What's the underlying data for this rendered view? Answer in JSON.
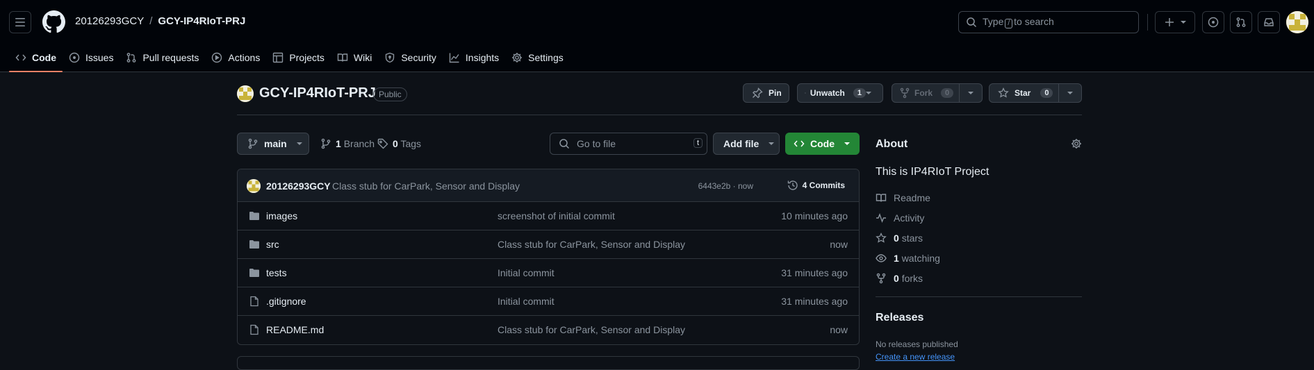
{
  "header": {
    "owner": "20126293GCY",
    "separator": "/",
    "repo": "GCY-IP4RIoT-PRJ",
    "search_pre": "Type",
    "search_key": "/",
    "search_post": "to search"
  },
  "tabs": [
    {
      "label": "Code",
      "icon": "code-icon"
    },
    {
      "label": "Issues",
      "icon": "issue-icon"
    },
    {
      "label": "Pull requests",
      "icon": "pull-request-icon"
    },
    {
      "label": "Actions",
      "icon": "play-icon"
    },
    {
      "label": "Projects",
      "icon": "table-icon"
    },
    {
      "label": "Wiki",
      "icon": "book-icon"
    },
    {
      "label": "Security",
      "icon": "shield-icon"
    },
    {
      "label": "Insights",
      "icon": "graph-icon"
    },
    {
      "label": "Settings",
      "icon": "gear-icon"
    }
  ],
  "repo_head": {
    "title": "GCY-IP4RIoT-PRJ",
    "visibility": "Public",
    "pin": "Pin",
    "unwatch": "Unwatch",
    "unwatch_count": "1",
    "fork": "Fork",
    "fork_count": "0",
    "star": "Star",
    "star_count": "0"
  },
  "branch_bar": {
    "branch": "main",
    "branches_count": "1",
    "branches_label": "Branch",
    "tags_count": "0",
    "tags_label": "Tags",
    "goto_placeholder": "Go to file",
    "goto_key": "t",
    "add_file": "Add file",
    "code": "Code"
  },
  "commit": {
    "user": "20126293GCY",
    "message": "Class stub for CarPark, Sensor and Display",
    "meta": "6443e2b · now",
    "commits": "4 Commits"
  },
  "files": [
    {
      "type": "folder",
      "name": "images",
      "message": "screenshot of initial commit",
      "time": "10 minutes ago"
    },
    {
      "type": "folder",
      "name": "src",
      "message": "Class stub for CarPark, Sensor and Display",
      "time": "now"
    },
    {
      "type": "folder",
      "name": "tests",
      "message": "Initial commit",
      "time": "31 minutes ago"
    },
    {
      "type": "file",
      "name": ".gitignore",
      "message": "Initial commit",
      "time": "31 minutes ago"
    },
    {
      "type": "file",
      "name": "README.md",
      "message": "Class stub for CarPark, Sensor and Display",
      "time": "now"
    }
  ],
  "about": {
    "title": "About",
    "description": "This is IP4RIoT Project",
    "readme": "Readme",
    "activity": "Activity",
    "stars_count": "0",
    "stars_label": "stars",
    "watching_count": "1",
    "watching_label": "watching",
    "forks_count": "0",
    "forks_label": "forks"
  },
  "releases": {
    "title": "Releases",
    "none": "No releases published",
    "create": "Create a new release"
  },
  "colors": {
    "background": "#0d1117",
    "header_bg": "#010409",
    "border": "#30363d",
    "accent_tab": "#f78166",
    "green_button": "#238636",
    "link": "#4493f8"
  }
}
